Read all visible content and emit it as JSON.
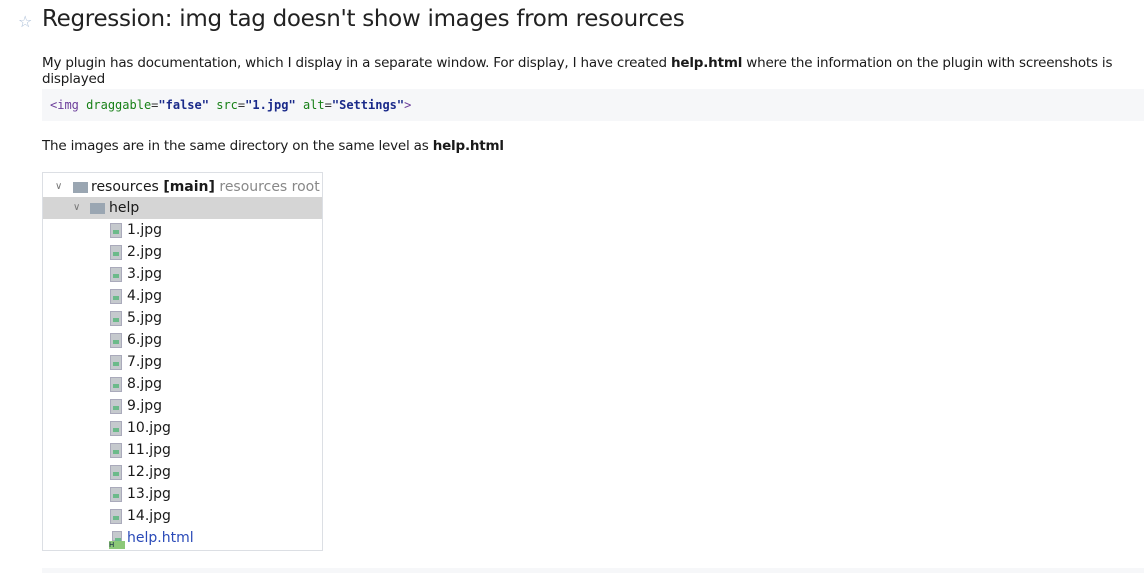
{
  "title": "Regression: img tag doesn't show images from resources",
  "para1": {
    "text": "My plugin has documentation, which I display in a separate window. For display, I have created ",
    "bold": "help.html",
    "rest": " where the information on the plugin with screenshots is displayed"
  },
  "code": {
    "open": "<img",
    "attr1": "draggable",
    "val1": "\"false\"",
    "attr2": "src",
    "val2": "\"1.jpg\"",
    "attr3": "alt",
    "val3": "\"Settings\"",
    "close": ">"
  },
  "para2": {
    "text": "The images are in the same directory on the same level as ",
    "bold": "help.html"
  },
  "tree": {
    "root": "resources",
    "root_module": "[main]",
    "root_hint": "resources root",
    "folder": "help",
    "files": [
      "1.jpg",
      "2.jpg",
      "3.jpg",
      "4.jpg",
      "5.jpg",
      "6.jpg",
      "7.jpg",
      "8.jpg",
      "9.jpg",
      "10.jpg",
      "11.jpg",
      "12.jpg",
      "13.jpg",
      "14.jpg"
    ],
    "html_file": "help.html",
    "html_color": "#2a4ab8"
  }
}
